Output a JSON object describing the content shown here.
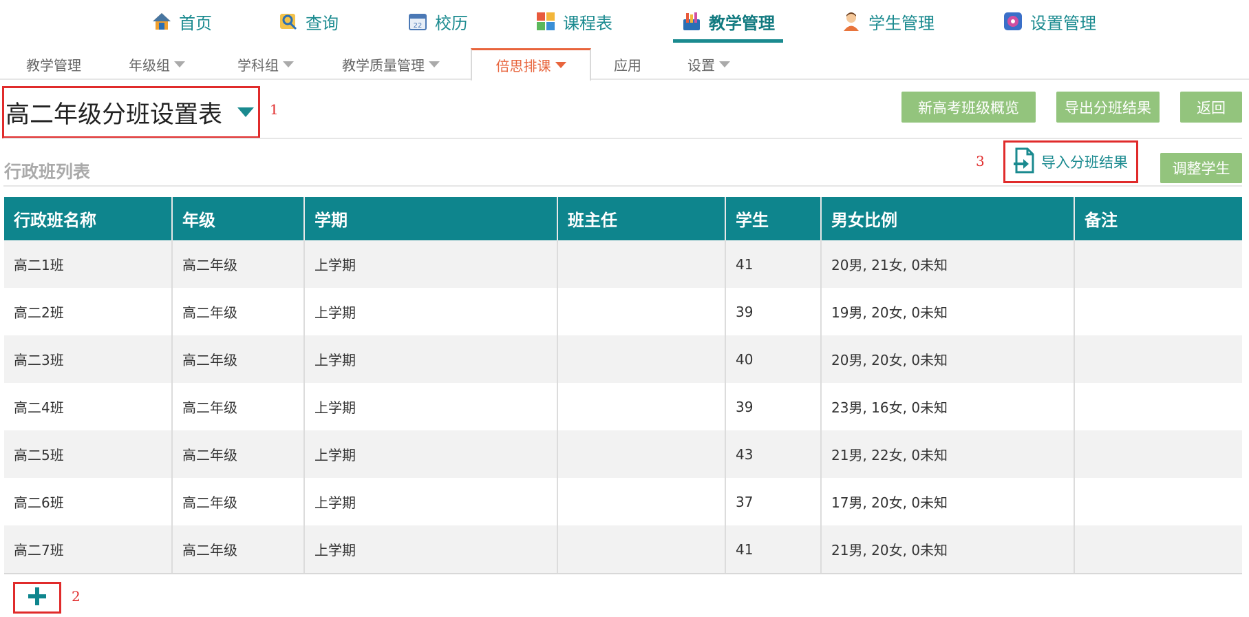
{
  "topnav": [
    {
      "label": "首页",
      "icon": "home-icon"
    },
    {
      "label": "查询",
      "icon": "search-icon"
    },
    {
      "label": "校历",
      "icon": "calendar-icon"
    },
    {
      "label": "课程表",
      "icon": "timetable-icon"
    },
    {
      "label": "教学管理",
      "icon": "teaching-icon",
      "active": true
    },
    {
      "label": "学生管理",
      "icon": "student-icon"
    },
    {
      "label": "设置管理",
      "icon": "settings-icon"
    }
  ],
  "subnav": [
    {
      "label": "教学管理"
    },
    {
      "label": "年级组"
    },
    {
      "label": "学科组"
    },
    {
      "label": "教学质量管理"
    },
    {
      "label": "倍思排课",
      "active": true
    },
    {
      "label": "应用"
    },
    {
      "label": "设置"
    }
  ],
  "header": {
    "title": "高二年级分班设置表",
    "buttons": [
      "新高考班级概览",
      "导出分班结果",
      "返回"
    ]
  },
  "section": {
    "title": "行政班列表",
    "import_label": "导入分班结果",
    "adjust_label": "调整学生"
  },
  "annotations": [
    "1",
    "2",
    "3"
  ],
  "table": {
    "columns": [
      "行政班名称",
      "年级",
      "学期",
      "班主任",
      "学生",
      "男女比例",
      "备注"
    ],
    "rows": [
      [
        "高二1班",
        "高二年级",
        "上学期",
        "",
        "41",
        "20男, 21女, 0未知",
        ""
      ],
      [
        "高二2班",
        "高二年级",
        "上学期",
        "",
        "39",
        "19男, 20女, 0未知",
        ""
      ],
      [
        "高二3班",
        "高二年级",
        "上学期",
        "",
        "40",
        "20男, 20女, 0未知",
        ""
      ],
      [
        "高二4班",
        "高二年级",
        "上学期",
        "",
        "39",
        "23男, 16女, 0未知",
        ""
      ],
      [
        "高二5班",
        "高二年级",
        "上学期",
        "",
        "43",
        "21男, 22女, 0未知",
        ""
      ],
      [
        "高二6班",
        "高二年级",
        "上学期",
        "",
        "37",
        "17男, 20女, 0未知",
        ""
      ],
      [
        "高二7班",
        "高二年级",
        "上学期",
        "",
        "41",
        "21男, 20女, 0未知",
        ""
      ]
    ]
  },
  "colors": {
    "teal": "#0e858d",
    "accent": "#e8643c",
    "button_green": "#93c47d",
    "annotation_red": "#e02b2b"
  }
}
